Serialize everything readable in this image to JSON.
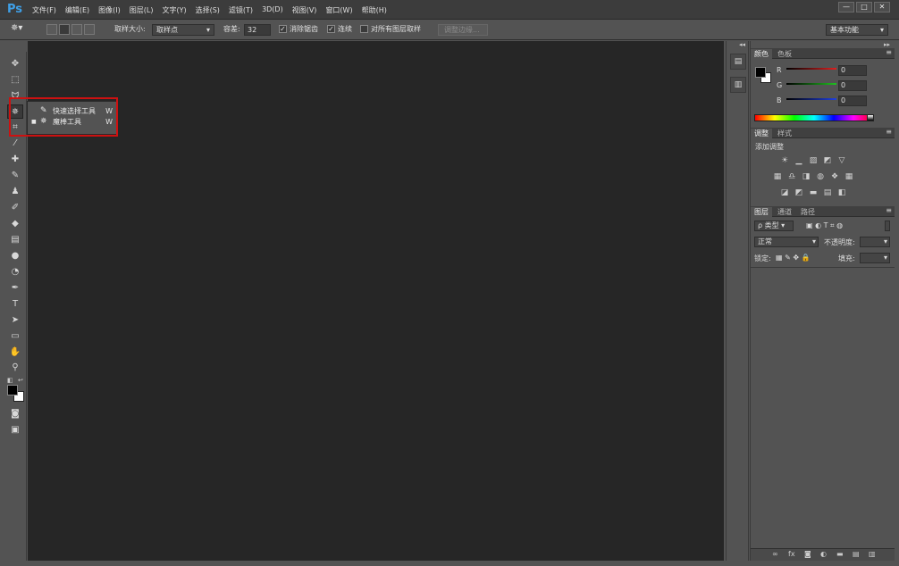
{
  "app": {
    "logo": "Ps"
  },
  "menu": [
    "文件(F)",
    "编辑(E)",
    "图像(I)",
    "图层(L)",
    "文字(Y)",
    "选择(S)",
    "滤镜(T)",
    "3D(D)",
    "视图(V)",
    "窗口(W)",
    "帮助(H)"
  ],
  "window_controls": {
    "minimize": "—",
    "maximize": "□",
    "close": "✕"
  },
  "options": {
    "sample_size_label": "取样大小:",
    "sample_size_value": "取样点",
    "tolerance_label": "容差:",
    "tolerance_value": "32",
    "antialias_label": "消除锯齿",
    "contiguous_label": "连续",
    "sample_all_label": "对所有图层取样",
    "refine_edge_label": "调整边缘...",
    "workspace_value": "基本功能"
  },
  "flyout": {
    "items": [
      {
        "label": "快速选择工具",
        "shortcut": "W"
      },
      {
        "label": "魔棒工具",
        "shortcut": "W"
      }
    ]
  },
  "panels": {
    "collapse_left": "◂◂",
    "collapse_right": "▸▸",
    "color_tabs": [
      "颜色",
      "色板"
    ],
    "channels": [
      {
        "label": "R",
        "value": "0",
        "color": "#e02020"
      },
      {
        "label": "G",
        "value": "0",
        "color": "#20c020"
      },
      {
        "label": "B",
        "value": "0",
        "color": "#2040e0"
      }
    ],
    "adjust_tabs": [
      "调整",
      "样式"
    ],
    "adjust_title": "添加调整",
    "layers_tabs": [
      "图层",
      "通道",
      "路径"
    ],
    "layers": {
      "filter_label": "ρ 类型",
      "blend_mode": "正常",
      "opacity_label": "不透明度:",
      "lock_label": "锁定:",
      "fill_label": "填充:"
    }
  },
  "colors": {
    "fg": "#000000",
    "bg": "#ffffff",
    "callout": "#cc1111"
  }
}
